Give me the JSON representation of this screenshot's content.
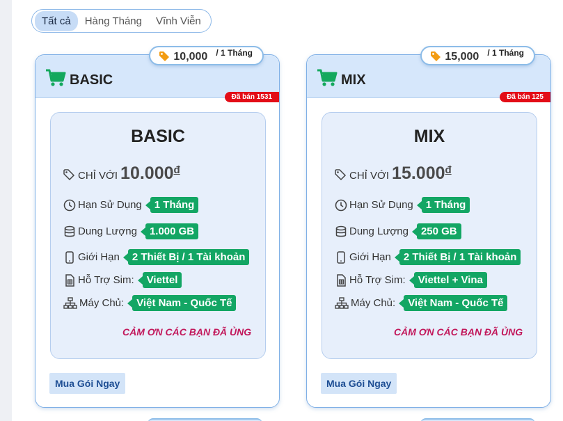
{
  "filters": {
    "tabs": [
      {
        "label": "Tất cả",
        "active": true
      },
      {
        "label": "Hàng Tháng",
        "active": false
      },
      {
        "label": "Vĩnh Viễn",
        "active": false
      }
    ]
  },
  "labels": {
    "chi_voi": "CHỈ VỚI",
    "currency": "đ",
    "han_su_dung": "Hạn Sử Dụng",
    "dung_luong": "Dung Lượng",
    "gioi_han": "Giới Hạn",
    "ho_tro_sim": "Hỗ Trợ Sim:",
    "may_chu": "Máy Chủ:",
    "thanks": "CẢM ƠN CÁC BẠN ĐÃ ỦNG HỘ",
    "buy": "Mua Gói Ngay"
  },
  "colors": {
    "accent": "#13a664",
    "sold_badge": "#e30d17",
    "thanks_text": "#c2185b",
    "header_bg": "#d6e7fb",
    "button_text": "#1e4e94"
  },
  "cards": [
    {
      "name": "BASIC",
      "price_pill": "10,000",
      "period": "/ 1 Tháng",
      "sold": "Đã bán 1531",
      "title": "BASIC",
      "price_big": "10.000",
      "duration": "1 Tháng",
      "capacity": "1.000 GB",
      "limit": "2 Thiết Bị / 1 Tài khoản",
      "sim": "Viettel",
      "server": "Việt Nam - Quốc Tế"
    },
    {
      "name": "MIX",
      "price_pill": "15,000",
      "period": "/ 1 Tháng",
      "sold": "Đã bán 125",
      "title": "MIX",
      "price_big": "15.000",
      "duration": "1 Tháng",
      "capacity": "250 GB",
      "limit": "2 Thiết Bị / 1 Tài khoản",
      "sim": "Viettel + Vina",
      "server": "Việt Nam - Quốc Tế"
    }
  ],
  "icons": [
    "cart-icon",
    "tag-icon",
    "clock-icon",
    "database-icon",
    "phone-icon",
    "sim-icon",
    "network-icon"
  ]
}
